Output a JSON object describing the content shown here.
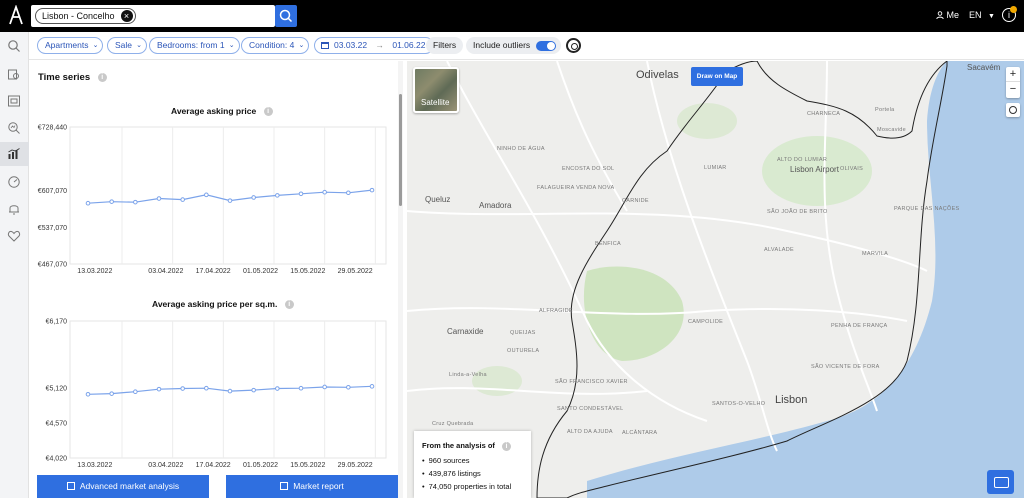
{
  "topbar": {
    "logo": "A",
    "search_chip": "Lisbon - Concelho",
    "user_label": "Me",
    "language": "EN",
    "icons": [
      "close-icon",
      "search-icon",
      "user-icon",
      "info-icon"
    ]
  },
  "sidebar": {
    "icons": [
      "search-icon",
      "valuation-icon",
      "listing-icon",
      "analysis-icon",
      "time-series-icon",
      "benchmark-icon",
      "alert-icon",
      "favorites-icon"
    ],
    "active": "time-series-icon"
  },
  "filters": {
    "property_type": "Apartments",
    "transaction": "Sale",
    "bedrooms": "Bedrooms: from 1",
    "condition": "Condition: 4",
    "date_from": "03.03.22",
    "date_arrow": "→",
    "date_to": "01.06.22",
    "filters_label": "Filters",
    "outliers_label": "Include outliers",
    "outliers_on": true
  },
  "panel": {
    "title": "Time series",
    "buttons": {
      "advanced": "Advanced market analysis",
      "report": "Market report"
    }
  },
  "colors": {
    "accent": "#2f6fe0",
    "line": "#7ba3ea",
    "topbar": "#000000"
  },
  "chart_data": [
    {
      "type": "line",
      "title": "Average asking price",
      "ylim": [
        467070,
        728440
      ],
      "yticks": [
        "€728,440",
        "€607,070",
        "€537,070",
        "€467,070"
      ],
      "ytick_values": [
        728440,
        607070,
        537070,
        467070
      ],
      "xticks": [
        "13.03.2022",
        "03.04.2022",
        "17.04.2022",
        "01.05.2022",
        "15.05.2022",
        "29.05.2022"
      ],
      "series": [
        {
          "values": [
            583000,
            586000,
            585000,
            592000,
            590000,
            599000,
            588000,
            594000,
            598000,
            601000,
            604000,
            603000,
            608000
          ]
        }
      ]
    },
    {
      "type": "line",
      "title": "Average asking price per sq.m.",
      "ylim": [
        4020,
        6170
      ],
      "yticks": [
        "€6,170",
        "€5,120",
        "€4,570",
        "€4,020"
      ],
      "ytick_values": [
        6170,
        5120,
        4570,
        4020
      ],
      "xticks": [
        "13.03.2022",
        "03.04.2022",
        "17.04.2022",
        "01.05.2022",
        "15.05.2022",
        "29.05.2022"
      ],
      "series": [
        {
          "values": [
            5020,
            5030,
            5060,
            5100,
            5110,
            5115,
            5070,
            5085,
            5110,
            5115,
            5135,
            5130,
            5145
          ]
        }
      ]
    }
  ],
  "map": {
    "satellite_label": "Satellite",
    "draw_label": "Draw on Map",
    "zoom_in": "+",
    "zoom_out": "−",
    "labels": [
      {
        "text": "Odivelas",
        "size": "map-big"
      },
      {
        "text": "Sacavém",
        "size": "map-med"
      },
      {
        "text": "CHARNECA",
        "size": "map-small"
      },
      {
        "text": "Lisbon Airport",
        "size": "map-med"
      },
      {
        "text": "Portela",
        "size": "map-small"
      },
      {
        "text": "Moscavide",
        "size": "map-small"
      },
      {
        "text": "NINHO DE ÁGUA",
        "size": "map-small"
      },
      {
        "text": "ENCOSTA DO SOL",
        "size": "map-small"
      },
      {
        "text": "LUMIAR",
        "size": "map-small"
      },
      {
        "text": "ALTO DO LUMIAR",
        "size": "map-small"
      },
      {
        "text": "OLIVAIS",
        "size": "map-small"
      },
      {
        "text": "Queluz",
        "size": "map-med"
      },
      {
        "text": "Amadora",
        "size": "map-med"
      },
      {
        "text": "FALAGUEIRA VENDA NOVA",
        "size": "map-small"
      },
      {
        "text": "CARNIDE",
        "size": "map-small"
      },
      {
        "text": "SÃO JOÃO DE BRITO",
        "size": "map-small"
      },
      {
        "text": "PARQUE DAS NAÇÕES",
        "size": "map-small"
      },
      {
        "text": "BENFICA",
        "size": "map-small"
      },
      {
        "text": "ALVALADE",
        "size": "map-small"
      },
      {
        "text": "MARVILA",
        "size": "map-small"
      },
      {
        "text": "ALFRAGIDE",
        "size": "map-small"
      },
      {
        "text": "Carnaxide",
        "size": "map-med"
      },
      {
        "text": "QUEIJAS",
        "size": "map-small"
      },
      {
        "text": "CAMPOLIDE",
        "size": "map-small"
      },
      {
        "text": "PENHA DE FRANÇA",
        "size": "map-small"
      },
      {
        "text": "OUTURELA",
        "size": "map-small"
      },
      {
        "text": "Linda-a-Velha",
        "size": "map-small"
      },
      {
        "text": "SÃO FRANCISCO XAVIER",
        "size": "map-small"
      },
      {
        "text": "SANTO CONDESTÁVEL",
        "size": "map-small"
      },
      {
        "text": "SÃO VICENTE DE FORA",
        "size": "map-small"
      },
      {
        "text": "SANTOS-O-VELHO",
        "size": "map-small"
      },
      {
        "text": "Lisbon",
        "size": "map-big"
      },
      {
        "text": "Cruz Quebrada",
        "size": "map-small"
      },
      {
        "text": "ALCÂNTARA",
        "size": "map-small"
      },
      {
        "text": "ALTO DA AJUDA",
        "size": "map-small"
      }
    ]
  },
  "analysis": {
    "heading": "From the analysis of",
    "sources": "960 sources",
    "listings": "439,876 listings",
    "properties": "74,050 properties in total"
  }
}
